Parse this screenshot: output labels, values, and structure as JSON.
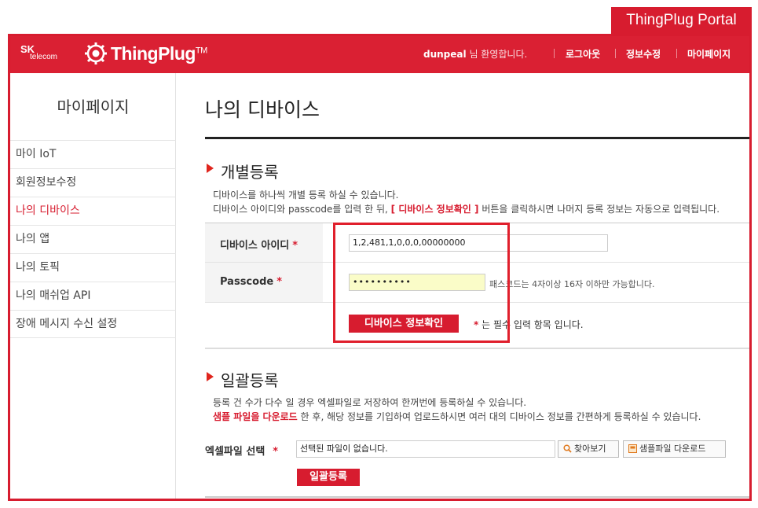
{
  "portal_label": "ThingPlug Portal",
  "header": {
    "sk_logo_top": "SK",
    "sk_logo_bottom": "telecom",
    "brand": "ThingPlug",
    "brand_tm": "TM",
    "username": "dunpeal",
    "greeting": "님 환영합니다.",
    "nav": [
      "로그아웃",
      "정보수정",
      "마이페이지"
    ]
  },
  "sidebar": {
    "title": "마이페이지",
    "items": [
      {
        "label": "마이 IoT"
      },
      {
        "label": "회원정보수정"
      },
      {
        "label": "나의 디바이스"
      },
      {
        "label": "나의 앱"
      },
      {
        "label": "나의 토픽"
      },
      {
        "label": "나의 매쉬업 API"
      },
      {
        "label": "장애 메시지 수신 설정"
      }
    ]
  },
  "main": {
    "page_title": "나의 디바이스",
    "individual": {
      "title": "개별등록",
      "desc1": "디바이스를 하나씩 개별 등록 하실 수 있습니다.",
      "desc2_pre": "디바이스 아이디와 passcode를 입력 한 뒤,",
      "desc2_hl": "[ 디바이스 정보확인 ]",
      "desc2_post": "버튼을 클릭하시면 나머지 등록 정보는 자동으로 입력됩니다.",
      "device_id_label": "디바이스 아이디",
      "device_id_value": "1,2,481,1,0,0,0,00000000",
      "passcode_label": "Passcode",
      "passcode_value": "••••••••••",
      "passcode_hint": "패스코드는 4자이상 16자 이하만 가능합니다.",
      "required_star": "*",
      "confirm_button": "디바이스 정보확인",
      "required_note": "는 필수 입력 항목 입니다."
    },
    "bulk": {
      "title": "일괄등록",
      "desc1": "등록 건 수가 다수 일 경우 엑셀파일로 저장하여 한꺼번에 등록하실 수 있습니다.",
      "desc2_hl": "샘플 파일을 다운로드",
      "desc2_post": "한 후, 해당 정보를 기입하여 업로드하시면 여러 대의 디바이스 정보를 간편하게 등록하실 수 있습니다.",
      "file_label": "엑셀파일 선택",
      "file_placeholder": "선택된 파일이 없습니다.",
      "browse_button": "찾아보기",
      "sample_button": "샘플파일 다운로드",
      "register_button": "일괄등록"
    }
  },
  "colors": {
    "brand_red": "#d71c2f",
    "passcode_bg": "#fafcc8"
  },
  "icons": [
    "gear-logo-icon",
    "search-icon",
    "file-download-icon",
    "arrow-bullet-icon"
  ]
}
